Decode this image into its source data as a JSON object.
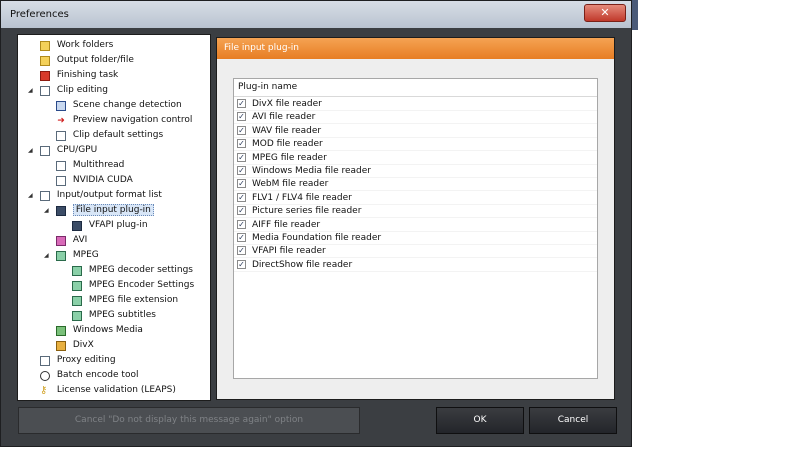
{
  "window": {
    "title": "Preferences",
    "close_icon": "close-icon"
  },
  "tree": [
    {
      "label": "Work folders",
      "icon": "folder-icon"
    },
    {
      "label": "Output folder/file",
      "icon": "output-folder-icon"
    },
    {
      "label": "Finishing task",
      "icon": "finishing-task-icon"
    },
    {
      "label": "Clip editing",
      "icon": "clip-editing-icon"
    },
    {
      "label": "Scene change detection",
      "icon": "scene-change-icon"
    },
    {
      "label": "Preview navigation control",
      "icon": "arrow-icon"
    },
    {
      "label": "Clip default settings",
      "icon": "settings-doc-icon"
    },
    {
      "label": "CPU/GPU",
      "icon": "cpu-gpu-icon"
    },
    {
      "label": "Multithread",
      "icon": "multithread-icon"
    },
    {
      "label": "NVIDIA CUDA",
      "icon": "cuda-icon"
    },
    {
      "label": "Input/output format list",
      "icon": "format-list-icon"
    },
    {
      "label": "File input plug-in",
      "icon": "monitor-icon"
    },
    {
      "label": "VFAPI plug-in",
      "icon": "monitor-icon"
    },
    {
      "label": "AVI",
      "icon": "avi-icon"
    },
    {
      "label": "MPEG",
      "icon": "mpeg-icon"
    },
    {
      "label": "MPEG decoder settings",
      "icon": "mpeg-settings-icon"
    },
    {
      "label": "MPEG Encoder Settings",
      "icon": "mpeg-settings-icon"
    },
    {
      "label": "MPEG file extension",
      "icon": "mpeg-settings-icon"
    },
    {
      "label": "MPEG subtitles",
      "icon": "mpeg-settings-icon"
    },
    {
      "label": "Windows Media",
      "icon": "windows-media-icon"
    },
    {
      "label": "DivX",
      "icon": "divx-icon"
    },
    {
      "label": "Proxy editing",
      "icon": "proxy-icon"
    },
    {
      "label": "Batch encode tool",
      "icon": "clock-icon"
    },
    {
      "label": "License validation (LEAPS)",
      "icon": "key-icon"
    }
  ],
  "panel": {
    "header": "File input plug-in",
    "column_header": "Plug-in name",
    "plugins": [
      {
        "name": "DivX file reader",
        "checked": true
      },
      {
        "name": "AVI file reader",
        "checked": true
      },
      {
        "name": "WAV file reader",
        "checked": true
      },
      {
        "name": "MOD file reader",
        "checked": true
      },
      {
        "name": "MPEG file reader",
        "checked": true
      },
      {
        "name": "Windows Media file reader",
        "checked": true
      },
      {
        "name": "WebM file reader",
        "checked": true
      },
      {
        "name": "FLV1 / FLV4 file reader",
        "checked": true
      },
      {
        "name": "Picture series file reader",
        "checked": true
      },
      {
        "name": "AIFF file reader",
        "checked": true
      },
      {
        "name": "Media Foundation file reader",
        "checked": true
      },
      {
        "name": "VFAPI file reader",
        "checked": true
      },
      {
        "name": "DirectShow file reader",
        "checked": true
      }
    ]
  },
  "buttons": {
    "cancel_message": "Cancel \"Do not display this message again\" option",
    "ok": "OK",
    "cancel": "Cancel"
  },
  "colors": {
    "header_orange": "#e77d23",
    "window_dark": "#3b3e42",
    "selection": "#d8e6f7"
  }
}
